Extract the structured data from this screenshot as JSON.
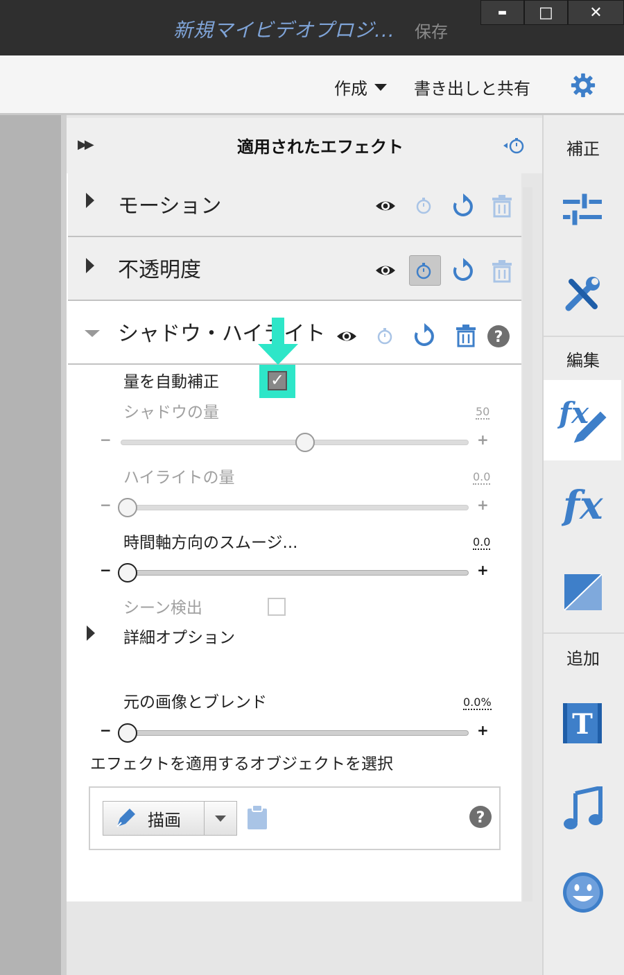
{
  "window": {
    "title": "新規マイビデオプロジ...",
    "save": "保存",
    "minimize": "▬",
    "maximize": "□",
    "close": "✕"
  },
  "menubar": {
    "create": "作成",
    "export_share": "書き出しと共有"
  },
  "panel": {
    "title": "適用されたエフェクト",
    "effects": [
      {
        "name": "モーション"
      },
      {
        "name": "不透明度"
      },
      {
        "name": "シャドウ・ハイライト"
      }
    ],
    "params": {
      "auto_amount": {
        "label": "量を自動補正",
        "checked": true
      },
      "shadow_amount": {
        "label": "シャドウの量",
        "value": "50",
        "fraction": 0.5
      },
      "highlight_amount": {
        "label": "ハイライトの量",
        "value": "0.0",
        "fraction": 0.0
      },
      "temporal_smoothing": {
        "label": "時間軸方向のスムージ...",
        "value": "0.0",
        "fraction": 0.0
      },
      "scene_detect": {
        "label": "シーン検出",
        "checked": false
      },
      "more_options": {
        "label": "詳細オプション"
      },
      "blend_with_original": {
        "label": "元の画像とブレンド",
        "value": "0.0%",
        "fraction": 0.0
      }
    },
    "minus": "−",
    "plus": "+",
    "object_select": {
      "label": "エフェクトを適用するオブジェクトを選択",
      "draw_button": "描画"
    }
  },
  "sidebar": {
    "adjust": "補正",
    "edit": "編集",
    "add": "追加"
  },
  "colors": {
    "accent_blue": "#3e7fc9",
    "highlight_cyan": "#2ee6c8",
    "title_blue": "#7fa4d8"
  }
}
